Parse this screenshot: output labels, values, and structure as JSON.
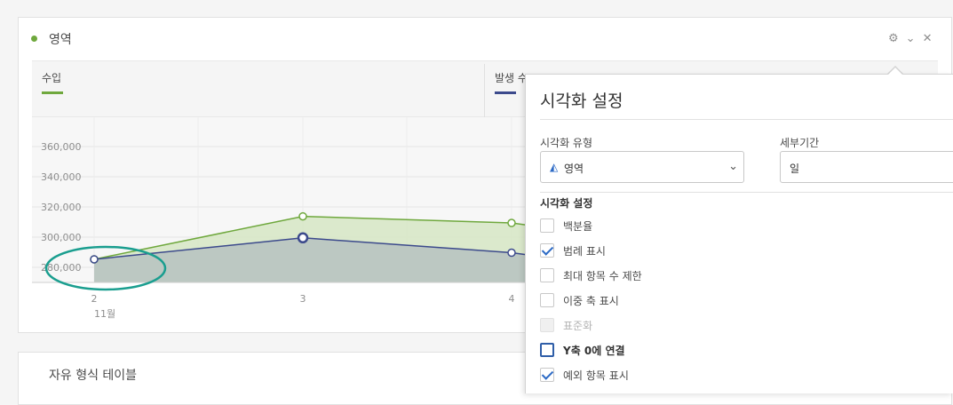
{
  "panel": {
    "title": "영역",
    "icons": {
      "settings": "⚙",
      "collapse": "⌄",
      "close": "✕"
    },
    "legend": [
      {
        "label": "수입",
        "color": "#6fa83d"
      },
      {
        "label": "발생 수",
        "color": "#3c4a8c"
      }
    ],
    "month_label": "11월"
  },
  "chart_data": {
    "type": "area",
    "x": [
      "2",
      "3",
      "4"
    ],
    "series": [
      {
        "name": "수입",
        "color": "#6fa83d",
        "values": [
          284000,
          310000,
          306000
        ]
      },
      {
        "name": "발생 수",
        "color": "#3c4a8c",
        "values": [
          284000,
          297000,
          288000
        ]
      }
    ],
    "yticks": [
      "360,000",
      "340,000",
      "320,000",
      "300,000",
      "280,000"
    ],
    "ylim": [
      270000,
      370000
    ],
    "grid": true
  },
  "second_panel": {
    "title": "자유 형식 테이블"
  },
  "viz_settings": {
    "title": "시각화 설정",
    "type_label": "시각화 유형",
    "type_value": "영역",
    "granularity_label": "세부기간",
    "granularity_value": "일",
    "section_label": "시각화 설정",
    "options": [
      {
        "label": "백분율",
        "checked": false,
        "disabled": false
      },
      {
        "label": "범례 표시",
        "checked": true,
        "disabled": false
      },
      {
        "label": "최대 항목 수 제한",
        "checked": false,
        "disabled": false
      },
      {
        "label": "이중 축 표시",
        "checked": false,
        "disabled": false
      },
      {
        "label": "표준화",
        "checked": false,
        "disabled": true
      },
      {
        "label": "Y축 0에 연결",
        "checked": false,
        "disabled": false
      },
      {
        "label": "예외 항목 표시",
        "checked": true,
        "disabled": false
      }
    ]
  },
  "annotation": {
    "color": "#1a9e8f"
  }
}
